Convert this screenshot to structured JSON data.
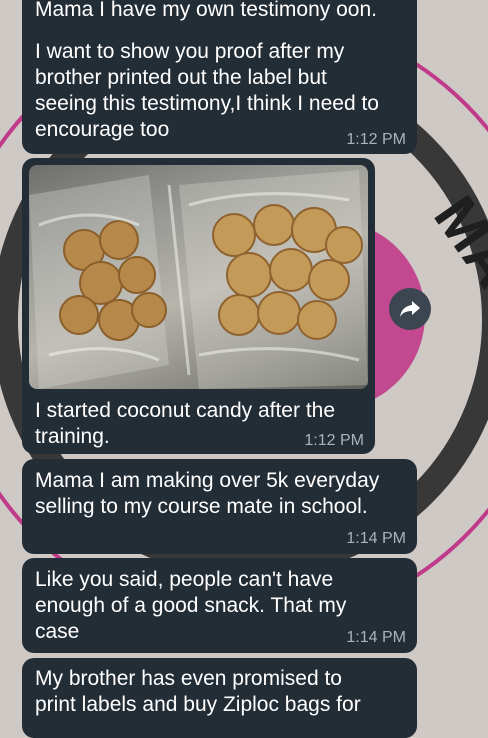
{
  "background": {
    "watermark_text": "MA",
    "colors": {
      "wallpaper": "#cfc9c6",
      "ring": "#c03a8a",
      "bubble": "#232d36",
      "meta": "#a9b3ba"
    }
  },
  "messages": [
    {
      "lines": [
        "Mama I have my own testimony oon.",
        "",
        "I want to show you proof after my",
        "brother printed out the label but",
        "seeing this testimony,I think I need to",
        "encourage too"
      ],
      "time": "1:12 PM"
    },
    {
      "caption_lines": [
        "I started coconut candy after the",
        "training."
      ],
      "time": "1:12 PM",
      "image": "photo-coconut-candy-bags"
    },
    {
      "lines": [
        "Mama I am making over 5k everyday",
        "selling to my course mate in school."
      ],
      "time": "1:14 PM"
    },
    {
      "lines": [
        "Like you said, people can't have",
        "enough of a good snack. That my",
        "case"
      ],
      "time": "1:14 PM"
    },
    {
      "lines": [
        "My brother has even promised to",
        "print labels and buy Ziploc bags for"
      ]
    }
  ],
  "icons": {
    "forward": "forward-arrow-icon"
  }
}
